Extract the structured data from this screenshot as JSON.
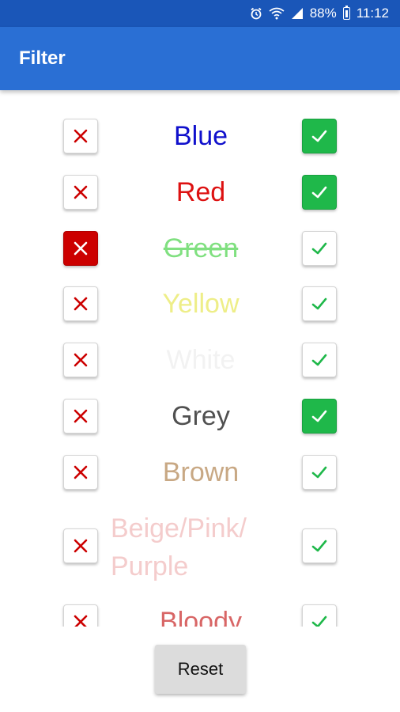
{
  "status_bar": {
    "battery": "88%",
    "time": "11:12",
    "icons": [
      "alarm-icon",
      "wifi-icon",
      "signal-icon",
      "battery-icon"
    ]
  },
  "app_bar": {
    "title": "Filter"
  },
  "filters": [
    {
      "label": "Blue",
      "color": "#1010cc",
      "excluded": false,
      "included": true,
      "strike": false
    },
    {
      "label": "Red",
      "color": "#dd1111",
      "excluded": false,
      "included": true,
      "strike": false
    },
    {
      "label": "Green",
      "color": "#80e080",
      "excluded": true,
      "included": false,
      "strike": true
    },
    {
      "label": "Yellow",
      "color": "#eeee88",
      "excluded": false,
      "included": false,
      "strike": false
    },
    {
      "label": "White",
      "color": "#f2f2f2",
      "excluded": false,
      "included": false,
      "strike": false
    },
    {
      "label": "Grey",
      "color": "#505050",
      "excluded": false,
      "included": true,
      "strike": false
    },
    {
      "label": "Brown",
      "color": "#c8a884",
      "excluded": false,
      "included": false,
      "strike": false
    },
    {
      "label": "Beige/Pink/\nPurple",
      "color": "#f4cccc",
      "excluded": false,
      "included": false,
      "strike": false
    },
    {
      "label": "Bloody",
      "color": "#d86666",
      "excluded": false,
      "included": false,
      "strike": false
    }
  ],
  "colors": {
    "status_bar": "#1a56b8",
    "app_bar": "#2a6fd4",
    "x_mark": "#cc0000",
    "check_mark": "#1fb84a"
  },
  "reset_button": {
    "label": "Reset"
  }
}
